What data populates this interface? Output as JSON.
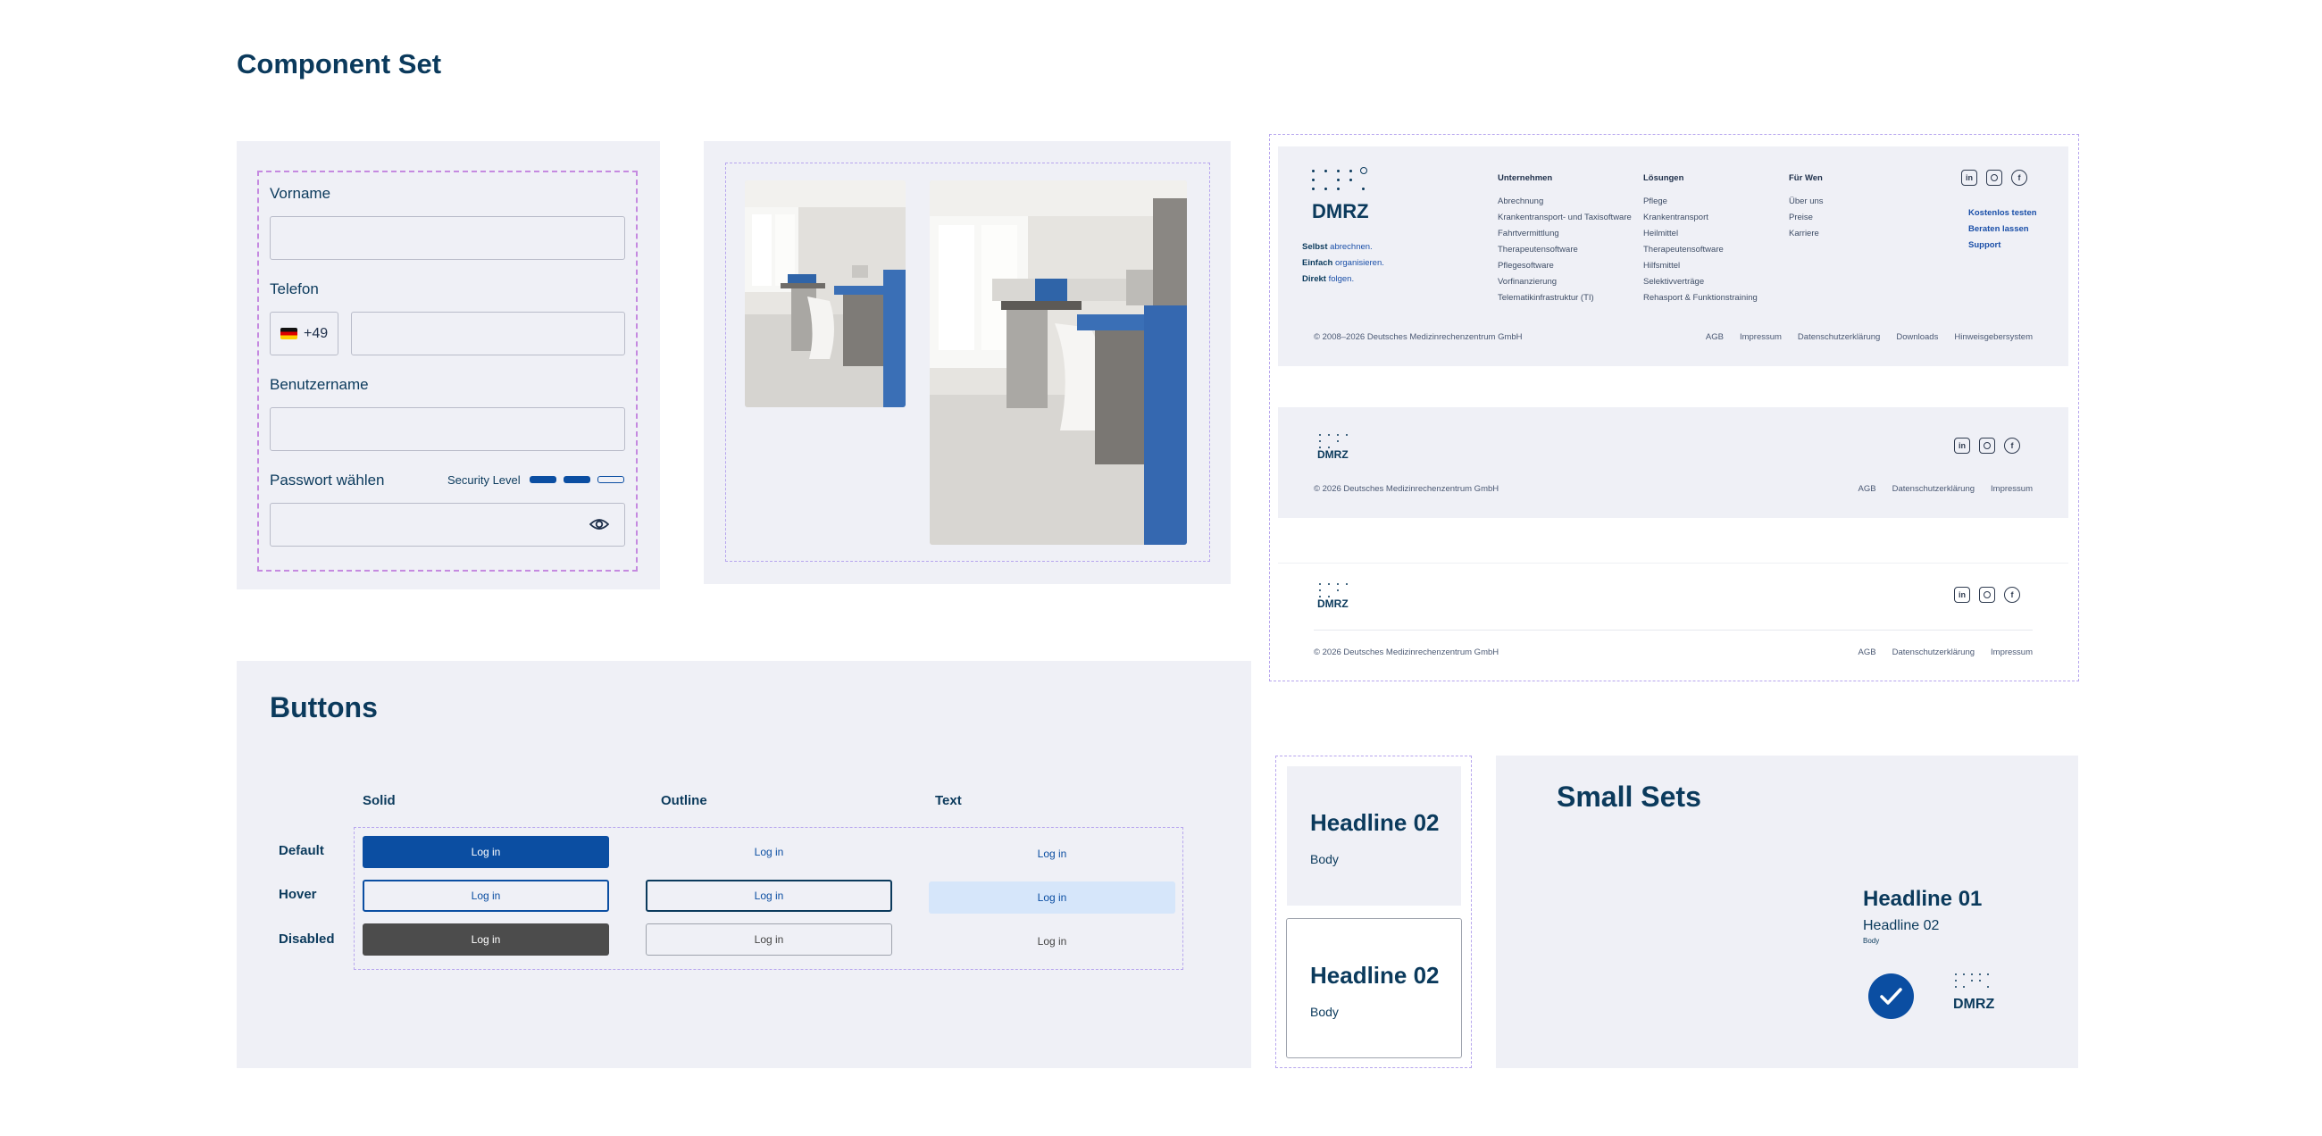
{
  "page_title": "Component Set",
  "form": {
    "first_name_label": "Vorname",
    "phone_label": "Telefon",
    "country_code": "+49",
    "username_label": "Benutzername",
    "password_label": "Passwort wählen",
    "security_label": "Security Level",
    "security_level_filled": 2,
    "security_level_total": 3
  },
  "footer_large": {
    "logo": "DMRZ",
    "tagline": [
      {
        "bold": "Selbst",
        "rest": " abrechnen."
      },
      {
        "bold": "Einfach",
        "rest": " organisieren."
      },
      {
        "bold": "Direkt",
        "rest": " folgen."
      }
    ],
    "columns": [
      {
        "heading": "Unternehmen",
        "items": [
          "Abrechnung",
          "Krankentransport- und Taxisoftware",
          "Fahrtvermittlung",
          "Therapeutensoftware",
          "Pflegesoftware",
          "Vorfinanzierung",
          "Telematikinfrastruktur (TI)"
        ]
      },
      {
        "heading": "Lösungen",
        "items": [
          "Pflege",
          "Krankentransport",
          "Heilmittel",
          "Therapeutensoftware",
          "Hilfsmittel",
          "Selektivverträge",
          "Rehasport & Funktionstraining"
        ]
      },
      {
        "heading": "Für Wen",
        "items": [
          "Über uns",
          "Preise",
          "Karriere"
        ]
      }
    ],
    "cta_links": [
      "Kostenlos testen",
      "Beraten lassen",
      "Support"
    ],
    "copyright": "© 2008–2026 Deutsches Medizinrechenzentrum GmbH",
    "bottom_links": [
      "AGB",
      "Impressum",
      "Datenschutzerklärung",
      "Downloads",
      "Hinweisgebersystem"
    ]
  },
  "footer_small": {
    "logo": "DMRZ",
    "copyright": "© 2026 Deutsches Medizinrechenzentrum GmbH",
    "links": [
      "AGB",
      "Datenschutzerklärung",
      "Impressum"
    ]
  },
  "footer_white": {
    "logo": "DMRZ",
    "copyright": "© 2026 Deutsches Medizinrechenzentrum GmbH",
    "links": [
      "AGB",
      "Datenschutzerklärung",
      "Impressum"
    ]
  },
  "social_icons": [
    "linkedin-icon",
    "instagram-icon",
    "facebook-icon"
  ],
  "buttons": {
    "title": "Buttons",
    "columns": [
      "Solid",
      "Outline",
      "Text"
    ],
    "rows": [
      "Default",
      "Hover",
      "Disabled"
    ],
    "label": "Log in"
  },
  "cards": [
    {
      "headline": "Headline 02",
      "body": "Body"
    },
    {
      "headline": "Headline 02",
      "body": "Body"
    }
  ],
  "small_sets": {
    "title": "Small Sets",
    "headline1": "Headline 01",
    "headline2": "Headline 02",
    "body": "Body",
    "logo": "DMRZ"
  },
  "colors": {
    "primary": "#0b4ea2",
    "text_dark": "#0b3a5c",
    "panel_bg": "#eff0f6",
    "hover_bg": "#d6e6fa",
    "disabled": "#4c4c4c",
    "dashed": "#b7a6ee"
  }
}
